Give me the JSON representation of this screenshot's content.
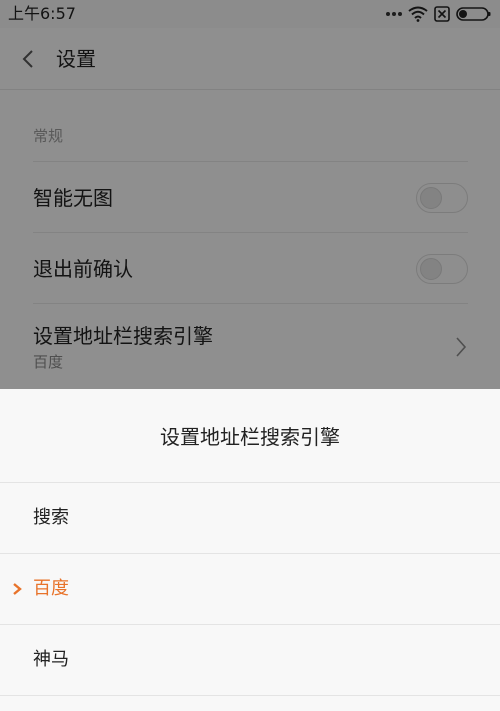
{
  "status_bar": {
    "time": "上午6:57",
    "icons": [
      "more-dots-icon",
      "wifi-icon",
      "sim-blocked-icon",
      "battery-icon"
    ]
  },
  "header": {
    "back_icon": "chevron-left-icon",
    "title": "设置"
  },
  "settings": {
    "section_title": "常规",
    "rows": [
      {
        "label": "智能无图",
        "control": "toggle",
        "on": false
      },
      {
        "label": "退出前确认",
        "control": "toggle",
        "on": false
      },
      {
        "label": "设置地址栏搜索引擎",
        "sublabel": "百度",
        "control": "chevron-right-icon"
      }
    ]
  },
  "sheet": {
    "title": "设置地址栏搜索引擎",
    "options": [
      {
        "label": "搜索",
        "selected": false
      },
      {
        "label": "百度",
        "selected": true
      },
      {
        "label": "神马",
        "selected": false
      }
    ]
  },
  "colors": {
    "accent": "#e8732a",
    "overlay": "rgba(0,0,0,0.42)",
    "sheet_background": "#f8f8f8"
  }
}
